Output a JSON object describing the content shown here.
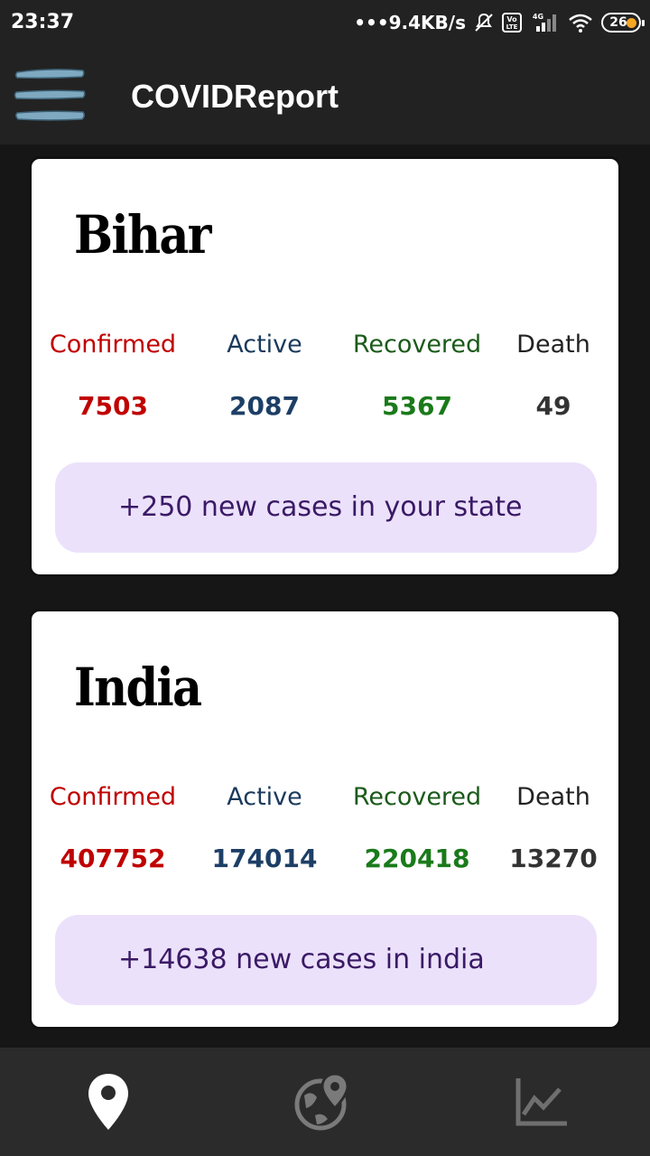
{
  "status_bar": {
    "time": "23:37",
    "network_speed": "•••9.4KB/s",
    "network_type": "4G",
    "battery": "26"
  },
  "app_bar": {
    "title": "COVIDReport",
    "menu_icon": "hamburger-menu-icon"
  },
  "cards": [
    {
      "title": "Bihar",
      "labels": {
        "confirmed": "Confirmed",
        "active": "Active",
        "recovered": "Recovered",
        "death": "Death"
      },
      "values": {
        "confirmed": "7503",
        "active": "2087",
        "recovered": "5367",
        "death": "49"
      },
      "notice": "+250 new cases in your state"
    },
    {
      "title": "India",
      "labels": {
        "confirmed": "Confirmed",
        "active": "Active",
        "recovered": "Recovered",
        "death": "Death"
      },
      "values": {
        "confirmed": "407752",
        "active": "174014",
        "recovered": "220418",
        "death": "13270"
      },
      "notice": "+14638 new cases in india"
    }
  ],
  "bottom_nav": [
    {
      "icon": "location-pin-icon",
      "selected": true
    },
    {
      "icon": "globe-location-icon",
      "selected": false
    },
    {
      "icon": "trend-chart-icon",
      "selected": false
    }
  ],
  "colors": {
    "confirmed": "#c00000",
    "active": "#1d3f66",
    "recovered": "#1a7a1a",
    "death": "#333333",
    "notice_bg": "#ece1fb",
    "notice_text": "#3a1a66",
    "app_bar": "#222222"
  }
}
